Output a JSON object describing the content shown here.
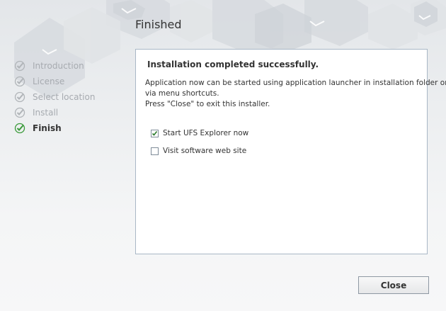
{
  "page": {
    "title": "Finished"
  },
  "steps": [
    {
      "label": "Introduction",
      "active": false
    },
    {
      "label": "License",
      "active": false
    },
    {
      "label": "Select location",
      "active": false
    },
    {
      "label": "Install",
      "active": false
    },
    {
      "label": "Finish",
      "active": true
    }
  ],
  "panel": {
    "heading": "Installation completed successfully.",
    "lines": [
      "Application now can be started using application launcher in installation folder or",
      "via menu shortcuts.",
      "Press \"Close\" to exit this installer."
    ],
    "options": [
      {
        "label": "Start UFS Explorer now",
        "checked": true
      },
      {
        "label": "Visit software web site",
        "checked": false
      }
    ]
  },
  "footer": {
    "close_label": "Close"
  },
  "colors": {
    "active_check": "#3a9a3a",
    "inactive_check": "#b0b4b8",
    "panel_border": "#a9b7c6"
  }
}
